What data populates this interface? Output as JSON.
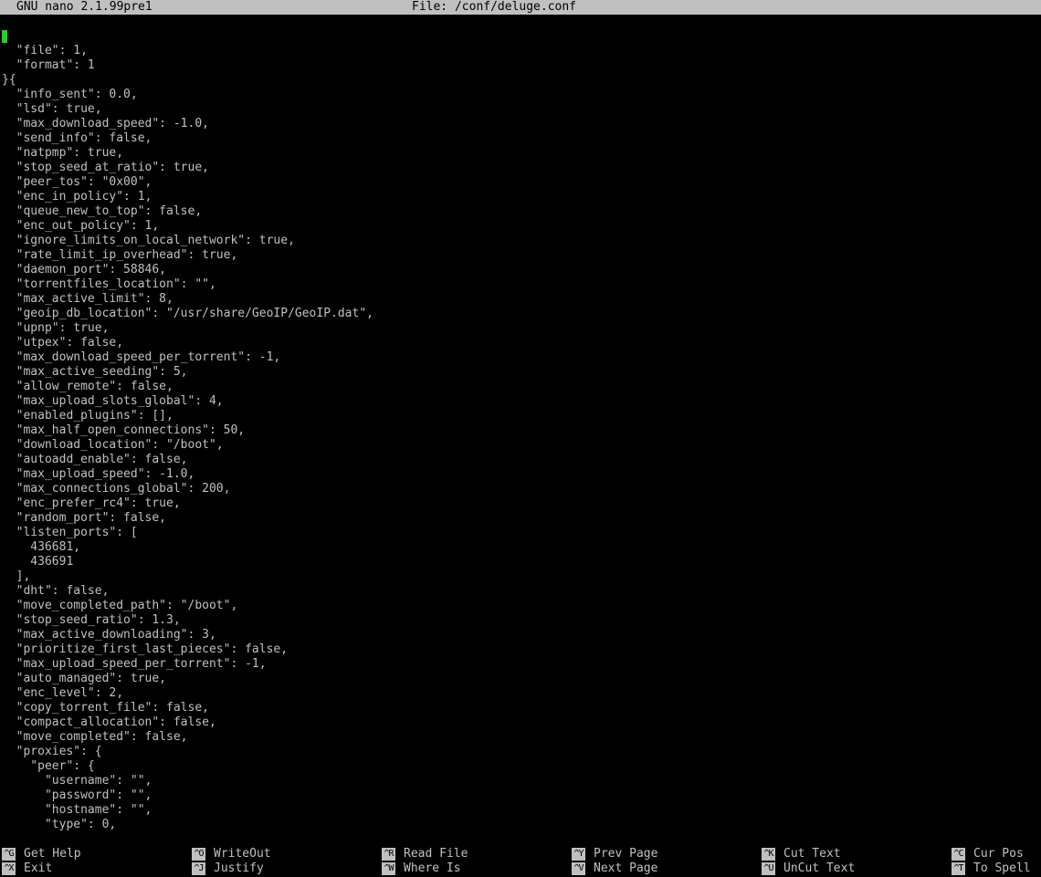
{
  "title_bar": {
    "app_name": "GNU nano 2.1.99pre1",
    "file_label": "File: /conf/deluge.conf"
  },
  "editor": {
    "cursor_color": "#22d422",
    "lines": [
      "{",
      "  \"file\": 1,",
      "  \"format\": 1",
      "}{",
      "  \"info_sent\": 0.0,",
      "  \"lsd\": true,",
      "  \"max_download_speed\": -1.0,",
      "  \"send_info\": false,",
      "  \"natpmp\": true,",
      "  \"stop_seed_at_ratio\": true,",
      "  \"peer_tos\": \"0x00\",",
      "  \"enc_in_policy\": 1,",
      "  \"queue_new_to_top\": false,",
      "  \"enc_out_policy\": 1,",
      "  \"ignore_limits_on_local_network\": true,",
      "  \"rate_limit_ip_overhead\": true,",
      "  \"daemon_port\": 58846,",
      "  \"torrentfiles_location\": \"\",",
      "  \"max_active_limit\": 8,",
      "  \"geoip_db_location\": \"/usr/share/GeoIP/GeoIP.dat\",",
      "  \"upnp\": true,",
      "  \"utpex\": false,",
      "  \"max_download_speed_per_torrent\": -1,",
      "  \"max_active_seeding\": 5,",
      "  \"allow_remote\": false,",
      "  \"max_upload_slots_global\": 4,",
      "  \"enabled_plugins\": [],",
      "  \"max_half_open_connections\": 50,",
      "  \"download_location\": \"/boot\",",
      "  \"autoadd_enable\": false,",
      "  \"max_upload_speed\": -1.0,",
      "  \"max_connections_global\": 200,",
      "  \"enc_prefer_rc4\": true,",
      "  \"random_port\": false,",
      "  \"listen_ports\": [",
      "    436681,",
      "    436691",
      "  ],",
      "  \"dht\": false,",
      "  \"move_completed_path\": \"/boot\",",
      "  \"stop_seed_ratio\": 1.3,",
      "  \"max_active_downloading\": 3,",
      "  \"prioritize_first_last_pieces\": false,",
      "  \"max_upload_speed_per_torrent\": -1,",
      "  \"auto_managed\": true,",
      "  \"enc_level\": 2,",
      "  \"copy_torrent_file\": false,",
      "  \"compact_allocation\": false,",
      "  \"move_completed\": false,",
      "  \"proxies\": {",
      "    \"peer\": {",
      "      \"username\": \"\",",
      "      \"password\": \"\",",
      "      \"hostname\": \"\",",
      "      \"type\": 0,"
    ]
  },
  "shortcuts": {
    "row1": [
      {
        "key": "^G",
        "label": "Get Help"
      },
      {
        "key": "^O",
        "label": "WriteOut"
      },
      {
        "key": "^R",
        "label": "Read File"
      },
      {
        "key": "^Y",
        "label": "Prev Page"
      },
      {
        "key": "^K",
        "label": "Cut Text"
      },
      {
        "key": "^C",
        "label": "Cur Pos"
      }
    ],
    "row2": [
      {
        "key": "^X",
        "label": "Exit"
      },
      {
        "key": "^J",
        "label": "Justify"
      },
      {
        "key": "^W",
        "label": "Where Is"
      },
      {
        "key": "^V",
        "label": "Next Page"
      },
      {
        "key": "^U",
        "label": "UnCut Text"
      },
      {
        "key": "^T",
        "label": "To Spell"
      }
    ]
  }
}
